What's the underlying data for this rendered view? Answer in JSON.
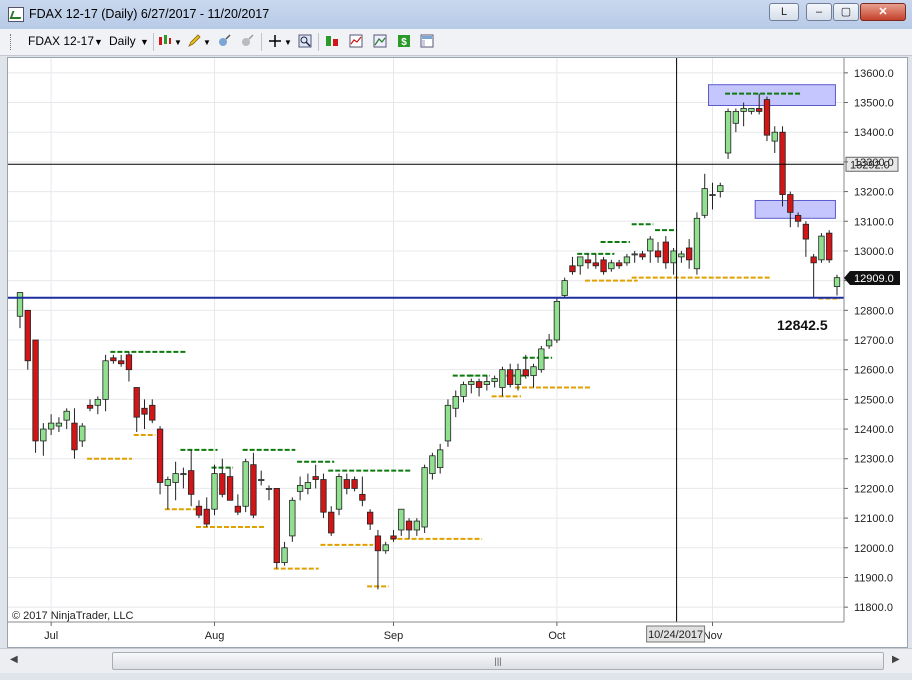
{
  "window": {
    "title": "FDAX 12-17 (Daily)  6/27/2017 - 11/20/2017",
    "buttons": {
      "lang": "L",
      "minimize": "–",
      "maximize": "▢",
      "close": "✕"
    }
  },
  "toolbar": {
    "instrument": "FDAX 12-17",
    "period": "Daily",
    "icons": [
      "bar-type-icon",
      "drawing-pencil-icon",
      "global-crosshair-icon",
      "pointer-icon",
      "crosshair-icon",
      "zoom-icon",
      "strategy-icon",
      "indicators-icon",
      "properties-icon",
      "chart-trader-icon",
      "data-box-icon"
    ]
  },
  "colors": {
    "up": "#90e090",
    "down": "#d01616",
    "blue_line": "#1c2fa0",
    "zone_fill": "#c6c6ff",
    "resistance": "#0c7a0c",
    "support": "#e0a000"
  },
  "chart_data": {
    "type": "candlestick",
    "title": "",
    "ylim": [
      11750,
      13650
    ],
    "y_ticks": [
      11800,
      11900,
      12000,
      12100,
      12200,
      12300,
      12400,
      12500,
      12600,
      12700,
      12800,
      12900,
      13000,
      13100,
      13200,
      13300,
      13400,
      13500,
      13600
    ],
    "y_tick_labels": [
      "11800.0",
      "11900.0",
      "12000.0",
      "12100.0",
      "12200.0",
      "12300.0",
      "12400.0",
      "12500.0",
      "12600.0",
      "12700.0",
      "12800.0",
      "12900.0",
      "13000.0",
      "13100.0",
      "13200.0",
      "13300.0",
      "13400.0",
      "13500.0",
      "13600.0"
    ],
    "x_tick_labels": [
      {
        "label": "Jul",
        "bar": 4
      },
      {
        "label": "Aug",
        "bar": 25
      },
      {
        "label": "Sep",
        "bar": 48
      },
      {
        "label": "Oct",
        "bar": 69
      },
      {
        "label": "Nov",
        "bar": 89
      }
    ],
    "grid": true,
    "candles": [
      {
        "o": 12780,
        "h": 12860,
        "l": 12740,
        "c": 12860
      },
      {
        "o": 12800,
        "h": 12800,
        "l": 12600,
        "c": 12630
      },
      {
        "o": 12700,
        "h": 12700,
        "l": 12320,
        "c": 12360
      },
      {
        "o": 12360,
        "h": 12420,
        "l": 12310,
        "c": 12400
      },
      {
        "o": 12400,
        "h": 12450,
        "l": 12380,
        "c": 12420
      },
      {
        "o": 12410,
        "h": 12440,
        "l": 12390,
        "c": 12420
      },
      {
        "o": 12430,
        "h": 12470,
        "l": 12400,
        "c": 12460
      },
      {
        "o": 12420,
        "h": 12470,
        "l": 12300,
        "c": 12330
      },
      {
        "o": 12360,
        "h": 12420,
        "l": 12340,
        "c": 12410
      },
      {
        "o": 12480,
        "h": 12500,
        "l": 12460,
        "c": 12470
      },
      {
        "o": 12480,
        "h": 12510,
        "l": 12450,
        "c": 12500
      },
      {
        "o": 12500,
        "h": 12650,
        "l": 12460,
        "c": 12630
      },
      {
        "o": 12640,
        "h": 12650,
        "l": 12620,
        "c": 12630
      },
      {
        "o": 12630,
        "h": 12650,
        "l": 12610,
        "c": 12620
      },
      {
        "o": 12650,
        "h": 12660,
        "l": 12560,
        "c": 12600
      },
      {
        "o": 12540,
        "h": 12540,
        "l": 12390,
        "c": 12440
      },
      {
        "o": 12470,
        "h": 12500,
        "l": 12400,
        "c": 12450
      },
      {
        "o": 12480,
        "h": 12500,
        "l": 12420,
        "c": 12430
      },
      {
        "o": 12400,
        "h": 12410,
        "l": 12180,
        "c": 12220
      },
      {
        "o": 12210,
        "h": 12240,
        "l": 12130,
        "c": 12230
      },
      {
        "o": 12220,
        "h": 12290,
        "l": 12160,
        "c": 12250
      },
      {
        "o": 12250,
        "h": 12270,
        "l": 12200,
        "c": 12250
      },
      {
        "o": 12260,
        "h": 12330,
        "l": 12140,
        "c": 12180
      },
      {
        "o": 12140,
        "h": 12160,
        "l": 12100,
        "c": 12110
      },
      {
        "o": 12130,
        "h": 12170,
        "l": 12070,
        "c": 12080
      },
      {
        "o": 12130,
        "h": 12280,
        "l": 12110,
        "c": 12250
      },
      {
        "o": 12250,
        "h": 12300,
        "l": 12170,
        "c": 12180
      },
      {
        "o": 12240,
        "h": 12270,
        "l": 12160,
        "c": 12160
      },
      {
        "o": 12140,
        "h": 12180,
        "l": 12110,
        "c": 12120
      },
      {
        "o": 12140,
        "h": 12300,
        "l": 12120,
        "c": 12290
      },
      {
        "o": 12280,
        "h": 12320,
        "l": 12100,
        "c": 12110
      },
      {
        "o": 12230,
        "h": 12260,
        "l": 12210,
        "c": 12230
      },
      {
        "o": 12200,
        "h": 12210,
        "l": 12160,
        "c": 12200
      },
      {
        "o": 12200,
        "h": 12200,
        "l": 11930,
        "c": 11950
      },
      {
        "o": 11950,
        "h": 12020,
        "l": 11940,
        "c": 12000
      },
      {
        "o": 12040,
        "h": 12170,
        "l": 12020,
        "c": 12160
      },
      {
        "o": 12190,
        "h": 12240,
        "l": 12160,
        "c": 12210
      },
      {
        "o": 12200,
        "h": 12250,
        "l": 12180,
        "c": 12220
      },
      {
        "o": 12240,
        "h": 12280,
        "l": 12200,
        "c": 12230
      },
      {
        "o": 12230,
        "h": 12250,
        "l": 12100,
        "c": 12120
      },
      {
        "o": 12120,
        "h": 12140,
        "l": 12040,
        "c": 12050
      },
      {
        "o": 12130,
        "h": 12250,
        "l": 12110,
        "c": 12240
      },
      {
        "o": 12230,
        "h": 12250,
        "l": 12180,
        "c": 12200
      },
      {
        "o": 12230,
        "h": 12240,
        "l": 12190,
        "c": 12200
      },
      {
        "o": 12180,
        "h": 12240,
        "l": 12140,
        "c": 12160
      },
      {
        "o": 12120,
        "h": 12130,
        "l": 12060,
        "c": 12080
      },
      {
        "o": 12040,
        "h": 12060,
        "l": 11860,
        "c": 11990
      },
      {
        "o": 11990,
        "h": 12020,
        "l": 11980,
        "c": 12010
      },
      {
        "o": 12040,
        "h": 12060,
        "l": 12020,
        "c": 12030
      },
      {
        "o": 12060,
        "h": 12130,
        "l": 12040,
        "c": 12130
      },
      {
        "o": 12090,
        "h": 12100,
        "l": 12030,
        "c": 12060
      },
      {
        "o": 12060,
        "h": 12100,
        "l": 12040,
        "c": 12090
      },
      {
        "o": 12070,
        "h": 12280,
        "l": 12050,
        "c": 12270
      },
      {
        "o": 12250,
        "h": 12320,
        "l": 12230,
        "c": 12310
      },
      {
        "o": 12270,
        "h": 12350,
        "l": 12250,
        "c": 12330
      },
      {
        "o": 12360,
        "h": 12500,
        "l": 12340,
        "c": 12480
      },
      {
        "o": 12470,
        "h": 12530,
        "l": 12440,
        "c": 12510
      },
      {
        "o": 12510,
        "h": 12560,
        "l": 12490,
        "c": 12550
      },
      {
        "o": 12550,
        "h": 12570,
        "l": 12520,
        "c": 12560
      },
      {
        "o": 12560,
        "h": 12570,
        "l": 12510,
        "c": 12540
      },
      {
        "o": 12550,
        "h": 12580,
        "l": 12530,
        "c": 12560
      },
      {
        "o": 12560,
        "h": 12580,
        "l": 12540,
        "c": 12570
      },
      {
        "o": 12540,
        "h": 12610,
        "l": 12510,
        "c": 12600
      },
      {
        "o": 12600,
        "h": 12620,
        "l": 12540,
        "c": 12550
      },
      {
        "o": 12550,
        "h": 12620,
        "l": 12530,
        "c": 12600
      },
      {
        "o": 12600,
        "h": 12650,
        "l": 12570,
        "c": 12580
      },
      {
        "o": 12580,
        "h": 12620,
        "l": 12540,
        "c": 12610
      },
      {
        "o": 12600,
        "h": 12680,
        "l": 12590,
        "c": 12670
      },
      {
        "o": 12680,
        "h": 12720,
        "l": 12670,
        "c": 12700
      },
      {
        "o": 12700,
        "h": 12840,
        "l": 12690,
        "c": 12830
      },
      {
        "o": 12850,
        "h": 12910,
        "l": 12840,
        "c": 12900
      },
      {
        "o": 12950,
        "h": 12980,
        "l": 12920,
        "c": 12930
      },
      {
        "o": 12950,
        "h": 12980,
        "l": 12920,
        "c": 12980
      },
      {
        "o": 12970,
        "h": 12990,
        "l": 12940,
        "c": 12960
      },
      {
        "o": 12960,
        "h": 12990,
        "l": 12940,
        "c": 12950
      },
      {
        "o": 12970,
        "h": 12980,
        "l": 12920,
        "c": 12930
      },
      {
        "o": 12940,
        "h": 12970,
        "l": 12930,
        "c": 12960
      },
      {
        "o": 12960,
        "h": 12970,
        "l": 12940,
        "c": 12950
      },
      {
        "o": 12960,
        "h": 12990,
        "l": 12950,
        "c": 12980
      },
      {
        "o": 12990,
        "h": 13000,
        "l": 12960,
        "c": 12990
      },
      {
        "o": 12990,
        "h": 13000,
        "l": 12970,
        "c": 12980
      },
      {
        "o": 13000,
        "h": 13050,
        "l": 12960,
        "c": 13040
      },
      {
        "o": 13000,
        "h": 13030,
        "l": 12960,
        "c": 12980
      },
      {
        "o": 13030,
        "h": 13050,
        "l": 12940,
        "c": 12960
      },
      {
        "o": 12960,
        "h": 13010,
        "l": 12920,
        "c": 13000
      },
      {
        "o": 12980,
        "h": 13000,
        "l": 12960,
        "c": 12990
      },
      {
        "o": 13010,
        "h": 13040,
        "l": 12940,
        "c": 12970
      },
      {
        "o": 12940,
        "h": 13130,
        "l": 12920,
        "c": 13110
      },
      {
        "o": 13120,
        "h": 13260,
        "l": 13110,
        "c": 13210
      },
      {
        "o": 13190,
        "h": 13230,
        "l": 13140,
        "c": 13190
      },
      {
        "o": 13200,
        "h": 13230,
        "l": 13180,
        "c": 13220
      },
      {
        "o": 13330,
        "h": 13480,
        "l": 13310,
        "c": 13470
      },
      {
        "o": 13430,
        "h": 13480,
        "l": 13400,
        "c": 13470
      },
      {
        "o": 13470,
        "h": 13500,
        "l": 13420,
        "c": 13480
      },
      {
        "o": 13470,
        "h": 13480,
        "l": 13460,
        "c": 13480
      },
      {
        "o": 13480,
        "h": 13530,
        "l": 13460,
        "c": 13470
      },
      {
        "o": 13510,
        "h": 13520,
        "l": 13370,
        "c": 13390
      },
      {
        "o": 13370,
        "h": 13420,
        "l": 13330,
        "c": 13400
      },
      {
        "o": 13400,
        "h": 13420,
        "l": 13150,
        "c": 13190
      },
      {
        "o": 13190,
        "h": 13200,
        "l": 13080,
        "c": 13130
      },
      {
        "o": 13120,
        "h": 13130,
        "l": 13080,
        "c": 13100
      },
      {
        "o": 13090,
        "h": 13100,
        "l": 12980,
        "c": 13040
      },
      {
        "o": 12980,
        "h": 12990,
        "l": 12840,
        "c": 12960
      },
      {
        "o": 12970,
        "h": 13060,
        "l": 12960,
        "c": 13050
      },
      {
        "o": 13060,
        "h": 13070,
        "l": 12960,
        "c": 12970
      },
      {
        "o": 12880,
        "h": 12920,
        "l": 12850,
        "c": 12910
      }
    ],
    "horizontal_lines": [
      {
        "name": "price-marker-line",
        "y": 13292.0,
        "label": "13292.0",
        "color": "#000000"
      },
      {
        "name": "blue-level-line",
        "y": 12842.5,
        "label": "12842.5",
        "color": "#1c2fa0"
      }
    ],
    "last_price": "12909.0",
    "vertical_line": {
      "date_label": "10/24/2017",
      "bar": 84
    },
    "supply_zones": [
      {
        "bar_start": 89,
        "bar_end": 103,
        "y_low": 13490,
        "y_high": 13560
      },
      {
        "bar_start": 95,
        "bar_end": 103,
        "y_low": 13110,
        "y_high": 13170
      }
    ],
    "resistance_levels": [
      {
        "bar_start": 12,
        "bar_end": 21,
        "y": 12660
      },
      {
        "bar_start": 21,
        "bar_end": 25,
        "y": 12330
      },
      {
        "bar_start": 25,
        "bar_end": 27,
        "y": 12270
      },
      {
        "bar_start": 29,
        "bar_end": 35,
        "y": 12330
      },
      {
        "bar_start": 36,
        "bar_end": 40,
        "y": 12290
      },
      {
        "bar_start": 40,
        "bar_end": 50,
        "y": 12260
      },
      {
        "bar_start": 56,
        "bar_end": 58,
        "y": 12580
      },
      {
        "bar_start": 58,
        "bar_end": 60,
        "y": 12580
      },
      {
        "bar_start": 62,
        "bar_end": 65,
        "y": 12580
      },
      {
        "bar_start": 65,
        "bar_end": 68,
        "y": 12640
      },
      {
        "bar_start": 72,
        "bar_end": 76,
        "y": 12990
      },
      {
        "bar_start": 75,
        "bar_end": 78,
        "y": 13030
      },
      {
        "bar_start": 79,
        "bar_end": 81,
        "y": 13090
      },
      {
        "bar_start": 82,
        "bar_end": 84,
        "y": 13070
      },
      {
        "bar_start": 91,
        "bar_end": 100,
        "y": 13530
      }
    ],
    "support_levels": [
      {
        "bar_start": 9,
        "bar_end": 14,
        "y": 12300
      },
      {
        "bar_start": 15,
        "bar_end": 17,
        "y": 12380
      },
      {
        "bar_start": 19,
        "bar_end": 23,
        "y": 12130
      },
      {
        "bar_start": 23,
        "bar_end": 31,
        "y": 12070
      },
      {
        "bar_start": 33,
        "bar_end": 38,
        "y": 11930
      },
      {
        "bar_start": 39,
        "bar_end": 45,
        "y": 12010
      },
      {
        "bar_start": 45,
        "bar_end": 47,
        "y": 11870
      },
      {
        "bar_start": 48,
        "bar_end": 59,
        "y": 12030
      },
      {
        "bar_start": 61,
        "bar_end": 64,
        "y": 12510
      },
      {
        "bar_start": 64,
        "bar_end": 73,
        "y": 12540
      },
      {
        "bar_start": 73,
        "bar_end": 79,
        "y": 12900
      },
      {
        "bar_start": 79,
        "bar_end": 96,
        "y": 12910
      },
      {
        "bar_start": 103,
        "bar_end": 105,
        "y": 12840
      }
    ],
    "copyright": "© 2017 NinjaTrader, LLC",
    "price_annotation": "12842.5"
  }
}
